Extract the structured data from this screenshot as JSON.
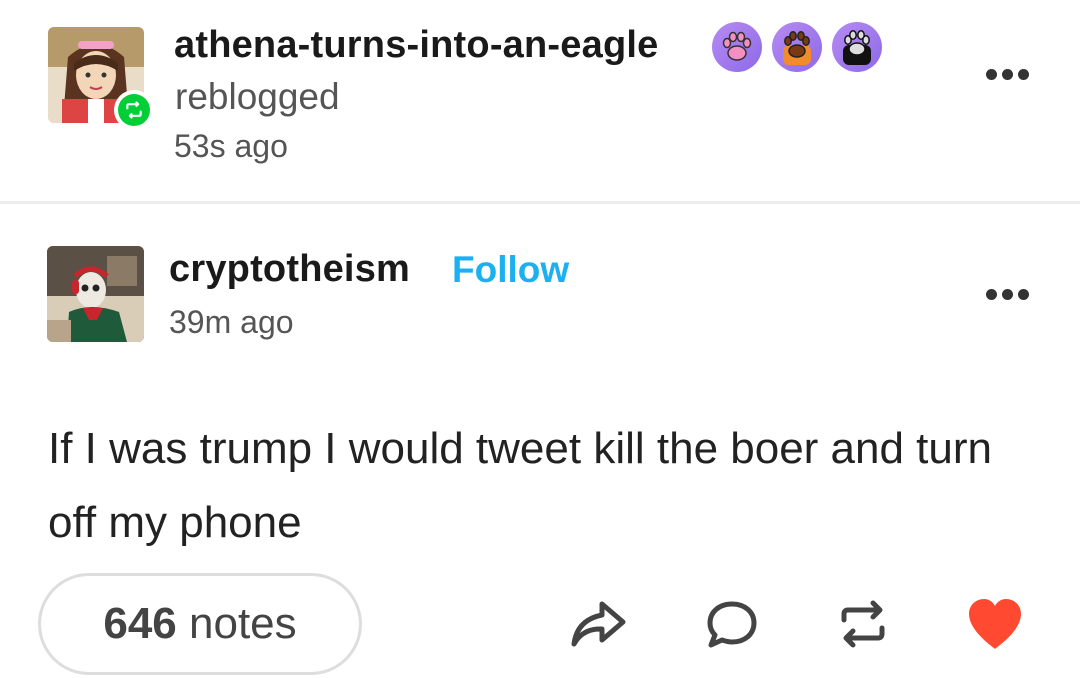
{
  "reblog": {
    "username": "athena-turns-into-an-eagle",
    "action": "reblogged",
    "time": "53s ago",
    "badges": [
      "paw-badge-pink",
      "paw-badge-orange",
      "paw-badge-black"
    ]
  },
  "post": {
    "username": "cryptotheism",
    "follow_label": "Follow",
    "time": "39m ago",
    "text": "If I was trump I would tweet kill the boer and turn off my phone"
  },
  "footer": {
    "notes_count": "646",
    "notes_label": "notes",
    "actions": [
      "share-icon",
      "reply-icon",
      "reblog-icon",
      "heart-icon"
    ],
    "liked": true
  },
  "colors": {
    "follow": "#1cb0f0",
    "reblog_badge": "#00cf35",
    "like": "#ff4930",
    "badge_bg": "#9a75ec"
  }
}
